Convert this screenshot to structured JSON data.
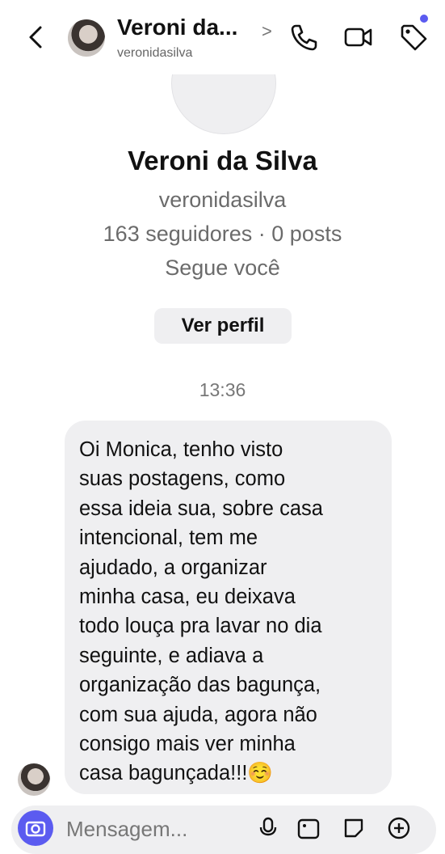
{
  "header": {
    "display_name": "Veroni da...",
    "username": "veronidasilva",
    "chevron": ">",
    "icons": [
      "back-icon",
      "phone-icon",
      "video-icon",
      "tag-icon"
    ],
    "accent_color": "#5b5bf0"
  },
  "profile": {
    "name": "Veroni da Silva",
    "username": "veronidasilva",
    "stats": "163 seguidores · 0 posts",
    "follow_status": "Segue você",
    "view_profile_label": "Ver perfil"
  },
  "conversation": {
    "timestamp": "13:36",
    "message_lines": [
      "Oi Monica, tenho visto",
      "suas postagens, como",
      "essa ideia sua, sobre casa",
      "intencional, tem me",
      "ajudado, a organizar",
      "minha casa, eu deixava",
      "todo louça pra lavar no dia",
      "seguinte, e adiava a",
      "organização das bagunça,",
      "com sua ajuda, agora não",
      "consigo mais ver minha",
      "casa bagunçada!!!☺️"
    ]
  },
  "composer": {
    "placeholder": "Mensagem...",
    "icons": [
      "camera-icon",
      "mic-icon",
      "gallery-icon",
      "sticker-icon",
      "add-icon"
    ]
  }
}
